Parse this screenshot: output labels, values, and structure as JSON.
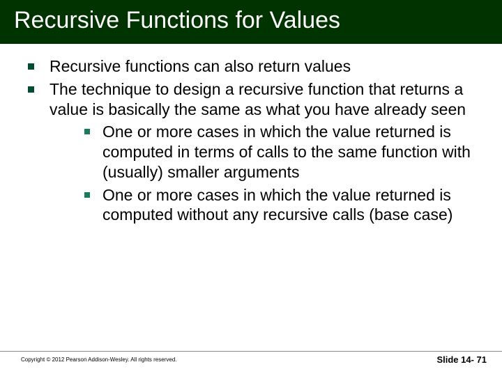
{
  "title": "Recursive Functions for Values",
  "bullets": [
    {
      "text": "Recursive functions can also return values"
    },
    {
      "text": "The technique to design a recursive function that returns a value is basically the same as what you have already seen",
      "sub": [
        {
          "text": "One or more cases in which the value returned is computed in terms of calls to the same function with (usually) smaller arguments"
        },
        {
          "text": "One or more cases in which the value returned is computed  without any recursive calls (base case)"
        }
      ]
    }
  ],
  "footer": {
    "copyright": "Copyright © 2012 Pearson Addison-Wesley.  All rights reserved.",
    "slide_label": "Slide 14- 71"
  }
}
